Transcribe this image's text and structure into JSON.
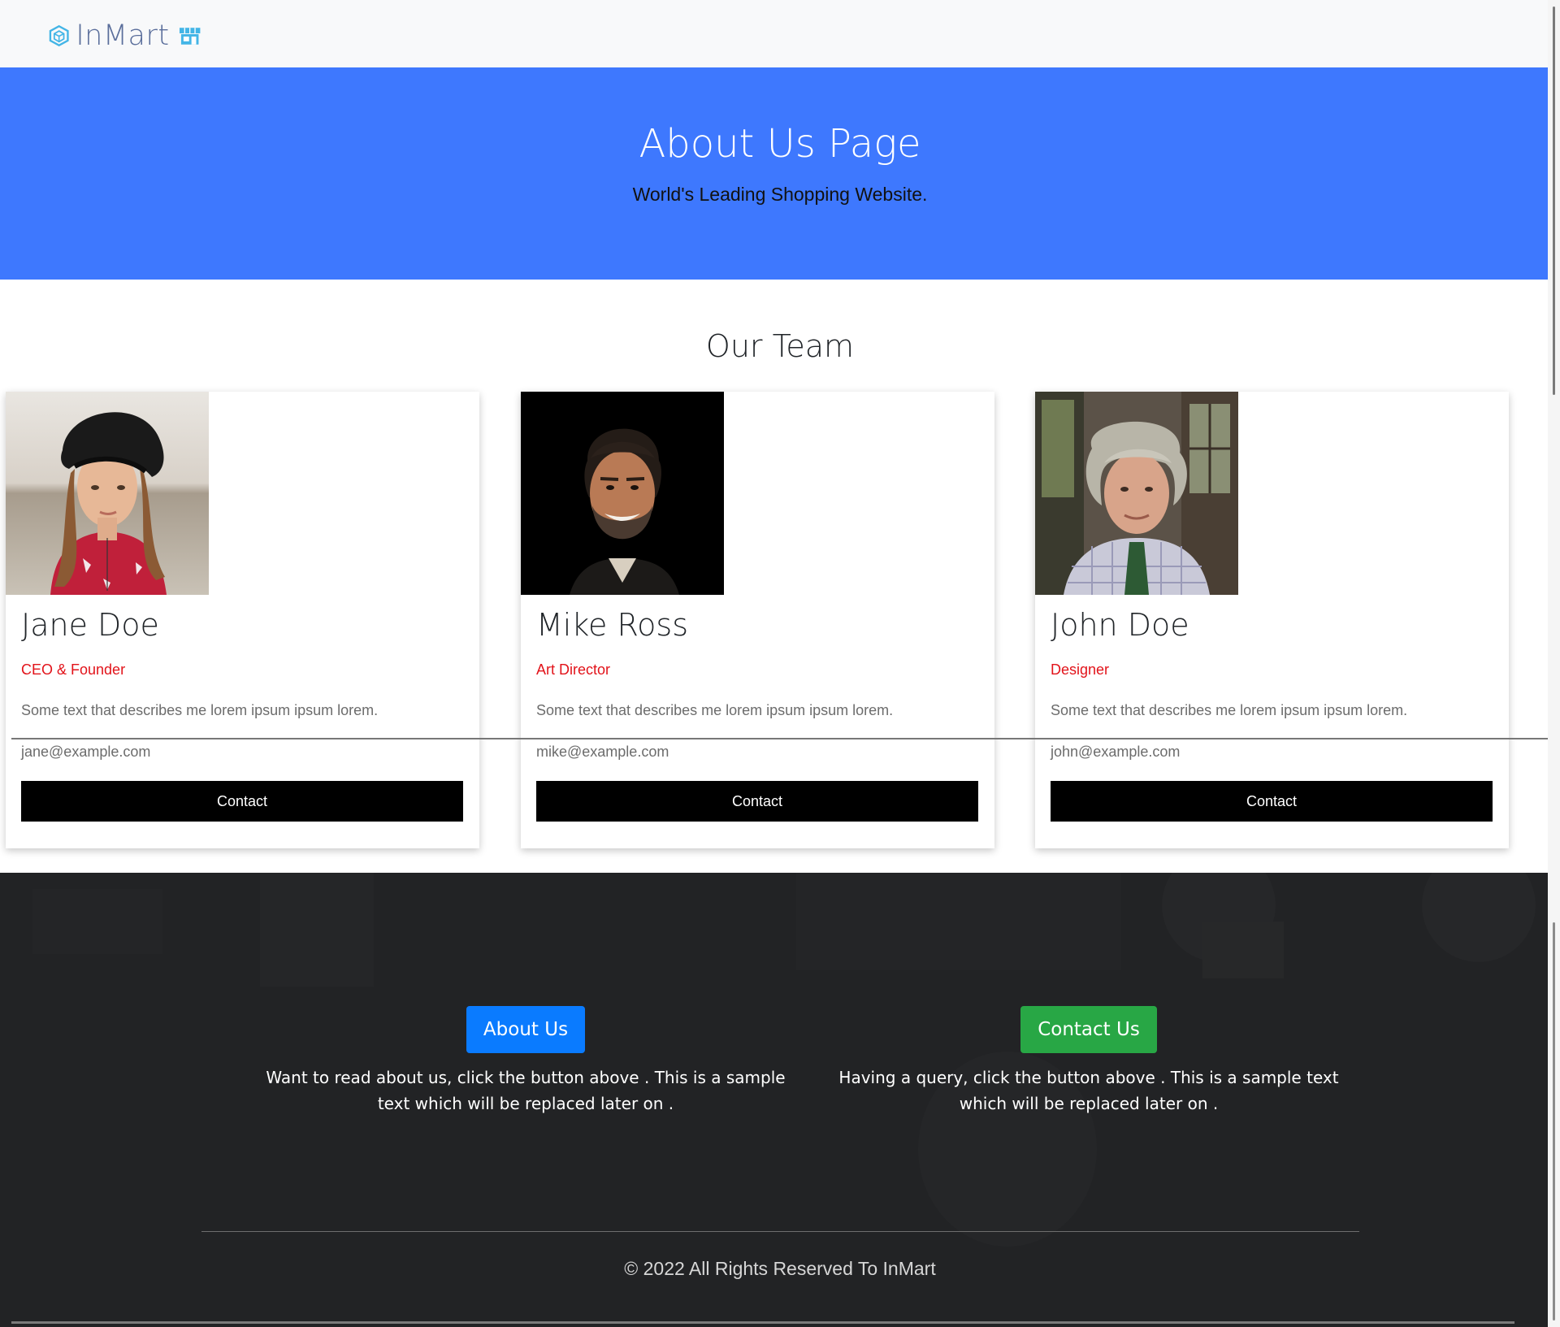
{
  "navbar": {
    "brand_text": "InMart",
    "brand_icon": "cube-icon",
    "store_icon": "store-icon",
    "brand_colors": [
      "#43b5e6",
      "#5a6e9b"
    ]
  },
  "hero": {
    "title": "About Us Page",
    "subtitle": "World's Leading Shopping Website.",
    "background": "#3e78fe"
  },
  "team": {
    "heading": "Our Team",
    "members": [
      {
        "name": "Jane Doe",
        "role": "CEO & Founder",
        "description": "Some text that describes me lorem ipsum ipsum lorem.",
        "email": "jane@example.com",
        "button_label": "Contact"
      },
      {
        "name": "Mike Ross",
        "role": "Art Director",
        "description": "Some text that describes me lorem ipsum ipsum lorem.",
        "email": "mike@example.com",
        "button_label": "Contact"
      },
      {
        "name": "John Doe",
        "role": "Designer",
        "description": "Some text that describes me lorem ipsum ipsum lorem.",
        "email": "john@example.com",
        "button_label": "Contact"
      }
    ],
    "role_color": "#e2131a"
  },
  "footer": {
    "about": {
      "button_label": "About Us",
      "text": "Want to read about us, click the button above . This is a sample text which will be replaced later on .",
      "color": "#0a7bff"
    },
    "contact": {
      "button_label": "Contact Us",
      "text": "Having a query, click the button above . This is a sample text which will be replaced later on .",
      "color": "#28a745"
    },
    "copyright": "© 2022 All Rights Reserved To InMart"
  }
}
